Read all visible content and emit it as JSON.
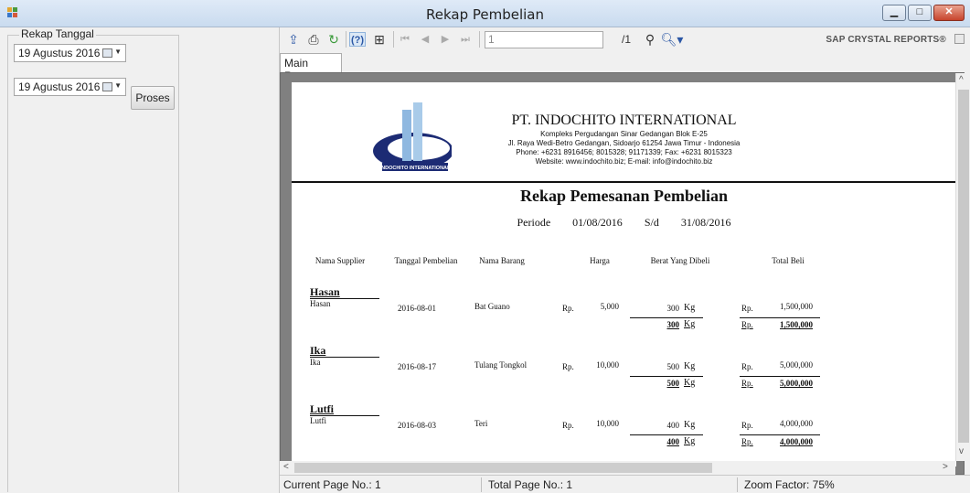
{
  "window": {
    "title": "Rekap Pembelian",
    "minimize": "▁",
    "maximize": "□",
    "close": "✕"
  },
  "left_panel": {
    "group_label": "Rekap Tanggal",
    "date_from": "19  Agustus  2016",
    "date_to": "19  Agustus  2016",
    "proses_button": "Proses"
  },
  "toolbar": {
    "page_input_value": "1",
    "total_pages": "/1",
    "brand": "SAP CRYSTAL REPORTS®"
  },
  "tab": {
    "main_report": "Main Report"
  },
  "report": {
    "company_name": "PT. INDOCHITO INTERNATIONAL",
    "address_lines": [
      "Kompleks Pergudangan Sinar Gedangan Blok E-25",
      "Jl. Raya Wedi-Betro Gedangan, Sidoarjo 61254 Jawa Timur - Indonesia",
      "Phone: +6231 8916456; 8015328; 91171339; Fax: +6231 8015323",
      "Website: www.indochito.biz; E-mail: info@indochito.biz"
    ],
    "logo_caption": "INDOCHITO INTERNATIONAL",
    "title": "Rekap Pemesanan Pembelian",
    "periode_label": "Periode",
    "periode_from": "01/08/2016",
    "periode_sep": "S/d",
    "periode_to": "31/08/2016",
    "columns": [
      "Nama Supplier",
      "Tanggal Pembelian",
      "Nama Barang",
      "Harga",
      "Berat Yang Dibeli",
      "Total Beli"
    ],
    "groups": [
      {
        "supplier": "Hasan",
        "row_supplier": "Hasan",
        "tanggal": "2016-08-01",
        "barang": "Bat Guano",
        "rp": "Rp.",
        "harga": "5,000",
        "berat": "300",
        "unit": "Kg",
        "total": "1,500,000",
        "sum_berat": "300",
        "sum_total": "1,500,000"
      },
      {
        "supplier": "Ika",
        "row_supplier": "Ika",
        "tanggal": "2016-08-17",
        "barang": "Tulang Tongkol",
        "rp": "Rp.",
        "harga": "10,000",
        "berat": "500",
        "unit": "Kg",
        "total": "5,000,000",
        "sum_berat": "500",
        "sum_total": "5,000,000"
      },
      {
        "supplier": "Lutfi",
        "row_supplier": "Lutfi",
        "tanggal": "2016-08-03",
        "barang": "Teri",
        "rp": "Rp.",
        "harga": "10,000",
        "berat": "400",
        "unit": "Kg",
        "total": "4,000,000",
        "sum_berat": "400",
        "sum_total": "4,000,000"
      }
    ]
  },
  "status": {
    "current_page": "Current Page No.: 1",
    "total_page": "Total Page No.: 1",
    "zoom": "Zoom Factor: 75%"
  }
}
